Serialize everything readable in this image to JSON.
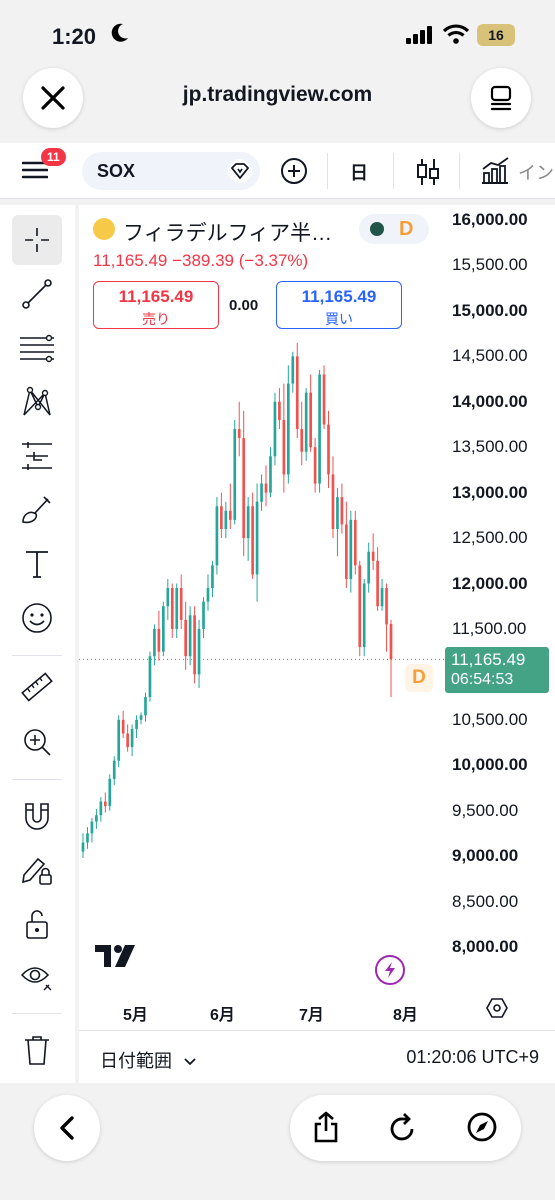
{
  "status": {
    "time": "1:20",
    "battery": "16"
  },
  "browser": {
    "url": "jp.tradingview.com"
  },
  "toolbar": {
    "notifications": "11",
    "symbol": "SOX",
    "interval": "日",
    "indicators": "イン"
  },
  "legend": {
    "title": "フィラデルフィア半…",
    "status_badge": "D",
    "quote": "11,165.49  −389.39 (−3.37%)",
    "sell_price": "11,165.49",
    "sell_label": "売り",
    "spread": "0.00",
    "buy_price": "11,165.49",
    "buy_label": "買い"
  },
  "price_tag": {
    "price": "11,165.49",
    "countdown": "06:54:53"
  },
  "session_badge": "D",
  "bottom": {
    "range_label": "日付範囲",
    "clock": "01:20:06 UTC+9"
  },
  "colors": {
    "up": "#26a69a",
    "down": "#ef5350",
    "accent": "#2962ff"
  },
  "chart_data": {
    "type": "candlestick",
    "ylim": [
      7700,
      16200
    ],
    "x_ticks": [
      "5月",
      "6月",
      "7月",
      "8月"
    ],
    "y_ticks": [
      {
        "value": 16000,
        "label": "16,000.00",
        "bold": true
      },
      {
        "value": 15500,
        "label": "15,500.00",
        "bold": false
      },
      {
        "value": 15000,
        "label": "15,000.00",
        "bold": true
      },
      {
        "value": 14500,
        "label": "14,500.00",
        "bold": false
      },
      {
        "value": 14000,
        "label": "14,000.00",
        "bold": true
      },
      {
        "value": 13500,
        "label": "13,500.00",
        "bold": false
      },
      {
        "value": 13000,
        "label": "13,000.00",
        "bold": true
      },
      {
        "value": 12500,
        "label": "12,500.00",
        "bold": false
      },
      {
        "value": 12000,
        "label": "12,000.00",
        "bold": true
      },
      {
        "value": 11500,
        "label": "11,500.00",
        "bold": false
      },
      {
        "value": 10500,
        "label": "10,500.00",
        "bold": false
      },
      {
        "value": 10000,
        "label": "10,000.00",
        "bold": true
      },
      {
        "value": 9500,
        "label": "9,500.00",
        "bold": false
      },
      {
        "value": 9000,
        "label": "9,000.00",
        "bold": true
      },
      {
        "value": 8500,
        "label": "8,500.00",
        "bold": false
      },
      {
        "value": 8000,
        "label": "8,000.00",
        "bold": true
      }
    ],
    "last_price": 11165.49,
    "candles": [
      {
        "o": 9050,
        "h": 9250,
        "l": 8980,
        "c": 9150
      },
      {
        "o": 9150,
        "h": 9320,
        "l": 9080,
        "c": 9250
      },
      {
        "o": 9250,
        "h": 9420,
        "l": 9150,
        "c": 9380
      },
      {
        "o": 9380,
        "h": 9520,
        "l": 9300,
        "c": 9450
      },
      {
        "o": 9450,
        "h": 9650,
        "l": 9380,
        "c": 9600
      },
      {
        "o": 9600,
        "h": 9700,
        "l": 9480,
        "c": 9550
      },
      {
        "o": 9550,
        "h": 9900,
        "l": 9500,
        "c": 9850
      },
      {
        "o": 9850,
        "h": 10100,
        "l": 9780,
        "c": 10050
      },
      {
        "o": 10050,
        "h": 10550,
        "l": 9980,
        "c": 10500
      },
      {
        "o": 10500,
        "h": 10600,
        "l": 10300,
        "c": 10350
      },
      {
        "o": 10350,
        "h": 10450,
        "l": 10150,
        "c": 10200
      },
      {
        "o": 10200,
        "h": 10450,
        "l": 10100,
        "c": 10400
      },
      {
        "o": 10400,
        "h": 10550,
        "l": 10300,
        "c": 10500
      },
      {
        "o": 10500,
        "h": 10580,
        "l": 10450,
        "c": 10550
      },
      {
        "o": 10550,
        "h": 10800,
        "l": 10480,
        "c": 10750
      },
      {
        "o": 10750,
        "h": 11250,
        "l": 10700,
        "c": 11200
      },
      {
        "o": 11200,
        "h": 11550,
        "l": 11100,
        "c": 11500
      },
      {
        "o": 11500,
        "h": 11700,
        "l": 11150,
        "c": 11250
      },
      {
        "o": 11250,
        "h": 11800,
        "l": 11200,
        "c": 11750
      },
      {
        "o": 11750,
        "h": 12050,
        "l": 11600,
        "c": 11950
      },
      {
        "o": 11950,
        "h": 12000,
        "l": 11400,
        "c": 11500
      },
      {
        "o": 11500,
        "h": 12000,
        "l": 11400,
        "c": 11950
      },
      {
        "o": 11950,
        "h": 12100,
        "l": 11500,
        "c": 11600
      },
      {
        "o": 11600,
        "h": 11800,
        "l": 11050,
        "c": 11200
      },
      {
        "o": 11200,
        "h": 11750,
        "l": 11100,
        "c": 11650
      },
      {
        "o": 11650,
        "h": 11750,
        "l": 10900,
        "c": 11000
      },
      {
        "o": 11000,
        "h": 11600,
        "l": 10850,
        "c": 11500
      },
      {
        "o": 11500,
        "h": 11850,
        "l": 11400,
        "c": 11800
      },
      {
        "o": 11800,
        "h": 12100,
        "l": 11700,
        "c": 11950
      },
      {
        "o": 11950,
        "h": 12250,
        "l": 11850,
        "c": 12200
      },
      {
        "o": 12200,
        "h": 12950,
        "l": 12100,
        "c": 12850
      },
      {
        "o": 12850,
        "h": 13000,
        "l": 12500,
        "c": 12600
      },
      {
        "o": 12600,
        "h": 12900,
        "l": 12500,
        "c": 12800
      },
      {
        "o": 12800,
        "h": 13100,
        "l": 12600,
        "c": 12700
      },
      {
        "o": 12700,
        "h": 13800,
        "l": 12650,
        "c": 13700
      },
      {
        "o": 13700,
        "h": 14000,
        "l": 13400,
        "c": 13600
      },
      {
        "o": 13600,
        "h": 13900,
        "l": 12300,
        "c": 12500
      },
      {
        "o": 12500,
        "h": 12950,
        "l": 12250,
        "c": 12850
      },
      {
        "o": 12850,
        "h": 13000,
        "l": 12050,
        "c": 12100
      },
      {
        "o": 12100,
        "h": 13100,
        "l": 11800,
        "c": 12900
      },
      {
        "o": 12900,
        "h": 13200,
        "l": 12800,
        "c": 13100
      },
      {
        "o": 13100,
        "h": 13300,
        "l": 12850,
        "c": 13000
      },
      {
        "o": 13000,
        "h": 13500,
        "l": 12950,
        "c": 13400
      },
      {
        "o": 13400,
        "h": 14100,
        "l": 13300,
        "c": 14000
      },
      {
        "o": 14000,
        "h": 14150,
        "l": 13700,
        "c": 13800
      },
      {
        "o": 13800,
        "h": 14200,
        "l": 13000,
        "c": 13200
      },
      {
        "o": 13200,
        "h": 14400,
        "l": 13100,
        "c": 14200
      },
      {
        "o": 14200,
        "h": 14550,
        "l": 14100,
        "c": 14500
      },
      {
        "o": 14500,
        "h": 14650,
        "l": 13600,
        "c": 13700
      },
      {
        "o": 13700,
        "h": 14000,
        "l": 13300,
        "c": 13450
      },
      {
        "o": 13450,
        "h": 14150,
        "l": 13350,
        "c": 14100
      },
      {
        "o": 14100,
        "h": 14300,
        "l": 13450,
        "c": 13500
      },
      {
        "o": 13500,
        "h": 13600,
        "l": 13000,
        "c": 13100
      },
      {
        "o": 13100,
        "h": 14350,
        "l": 13000,
        "c": 14300
      },
      {
        "o": 14300,
        "h": 14400,
        "l": 13700,
        "c": 13750
      },
      {
        "o": 13750,
        "h": 13900,
        "l": 13050,
        "c": 13200
      },
      {
        "o": 13200,
        "h": 13400,
        "l": 12500,
        "c": 12600
      },
      {
        "o": 12600,
        "h": 13050,
        "l": 12300,
        "c": 12950
      },
      {
        "o": 12950,
        "h": 13100,
        "l": 12550,
        "c": 12650
      },
      {
        "o": 12650,
        "h": 12900,
        "l": 11950,
        "c": 12050
      },
      {
        "o": 12050,
        "h": 12800,
        "l": 11900,
        "c": 12700
      },
      {
        "o": 12700,
        "h": 12800,
        "l": 12100,
        "c": 12200
      },
      {
        "o": 12200,
        "h": 12250,
        "l": 11200,
        "c": 11300
      },
      {
        "o": 11300,
        "h": 12050,
        "l": 11200,
        "c": 12000
      },
      {
        "o": 12000,
        "h": 12450,
        "l": 11900,
        "c": 12350
      },
      {
        "o": 12350,
        "h": 12550,
        "l": 12150,
        "c": 12250
      },
      {
        "o": 12250,
        "h": 12400,
        "l": 11700,
        "c": 11750
      },
      {
        "o": 11750,
        "h": 12050,
        "l": 11700,
        "c": 11950
      },
      {
        "o": 11950,
        "h": 12000,
        "l": 11250,
        "c": 11550
      },
      {
        "o": 11555,
        "h": 11600,
        "l": 10750,
        "c": 11165
      }
    ]
  }
}
